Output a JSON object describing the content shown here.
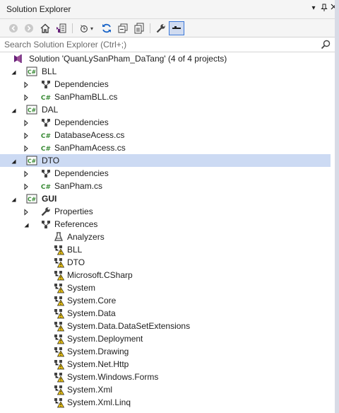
{
  "window": {
    "title": "Solution Explorer"
  },
  "toolbar": {
    "buttons": [
      "back-icon",
      "forward-icon",
      "home-icon",
      "switch-views-icon",
      "pending-changes-filter-icon",
      "sync-icon",
      "collapse-all-icon",
      "show-all-files-icon",
      "properties-icon",
      "preview-icon"
    ]
  },
  "search": {
    "placeholder": "Search Solution Explorer (Ctrl+;)"
  },
  "tree": {
    "solution": "Solution 'QuanLySanPham_DaTang' (4 of 4 projects)",
    "rows": [
      {
        "label": "BLL"
      },
      {
        "label": "Dependencies"
      },
      {
        "label": "SanPhamBLL.cs"
      },
      {
        "label": "DAL"
      },
      {
        "label": "Dependencies"
      },
      {
        "label": "DatabaseAcess.cs"
      },
      {
        "label": "SanPhamAcess.cs"
      },
      {
        "label": "DTO"
      },
      {
        "label": "Dependencies"
      },
      {
        "label": "SanPham.cs"
      },
      {
        "label": "GUI"
      },
      {
        "label": "Properties"
      },
      {
        "label": "References"
      },
      {
        "label": "Analyzers"
      },
      {
        "label": "BLL"
      },
      {
        "label": "DTO"
      },
      {
        "label": "Microsoft.CSharp"
      },
      {
        "label": "System"
      },
      {
        "label": "System.Core"
      },
      {
        "label": "System.Data"
      },
      {
        "label": "System.Data.DataSetExtensions"
      },
      {
        "label": "System.Deployment"
      },
      {
        "label": "System.Drawing"
      },
      {
        "label": "System.Net.Http"
      },
      {
        "label": "System.Windows.Forms"
      },
      {
        "label": "System.Xml"
      },
      {
        "label": "System.Xml.Linq"
      }
    ]
  },
  "colors": {
    "selection": "#ccdaf3",
    "csharp": "#388a34",
    "vs_purple": "#68217a",
    "warning": "#f2c811"
  }
}
